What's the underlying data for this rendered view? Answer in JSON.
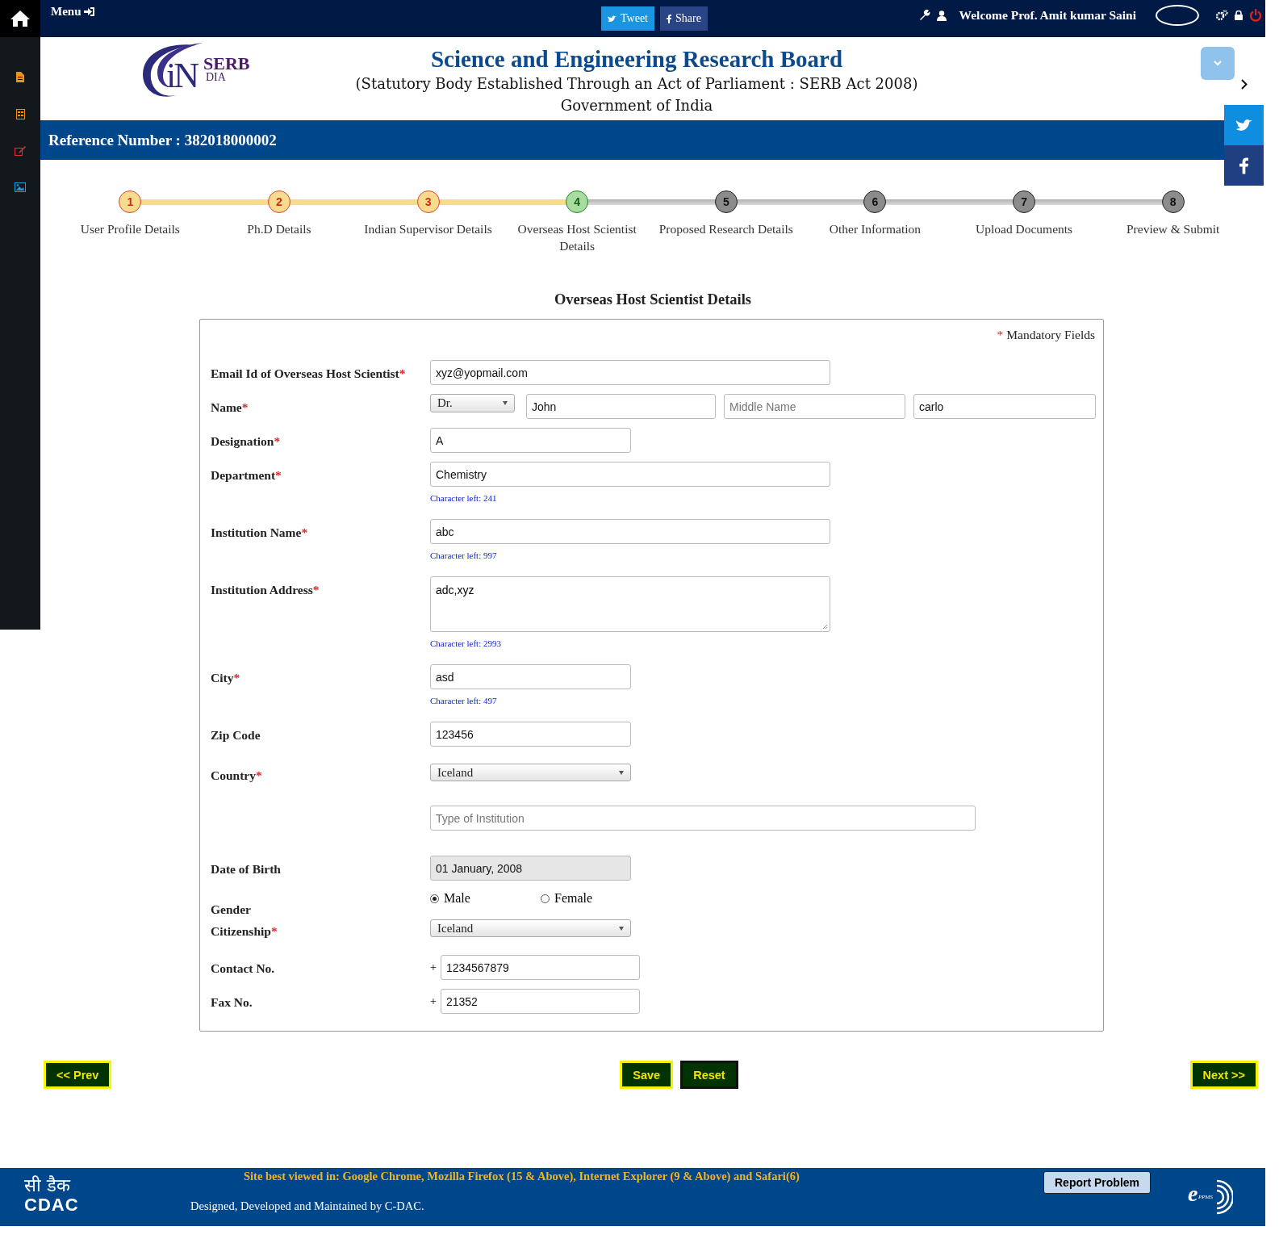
{
  "topbar": {
    "menu": "Menu",
    "tweet": "Tweet",
    "share": "Share",
    "welcome": "Welcome Prof. Amit kumar Saini"
  },
  "header": {
    "logo": {
      "mark": "iN",
      "serb": "SERB",
      "dia": "DIA"
    },
    "title": "Science and Engineering Research Board",
    "subtitle": "(Statutory Body Established Through an Act of Parliament : SERB Act 2008)",
    "government": "Government of India"
  },
  "reference": "Reference Number : 382018000002",
  "steps": [
    {
      "number": "1",
      "label": "User Profile Details",
      "completed": true,
      "selected": false
    },
    {
      "number": "2",
      "label": "Ph.D Details",
      "completed": true,
      "selected": false
    },
    {
      "number": "3",
      "label": "Indian Supervisor Details",
      "completed": true,
      "selected": false
    },
    {
      "number": "4",
      "label": "Overseas Host Scientist Details",
      "completed": false,
      "selected": true
    },
    {
      "number": "5",
      "label": "Proposed Research Details",
      "completed": false,
      "selected": false
    },
    {
      "number": "6",
      "label": "Other Information",
      "completed": false,
      "selected": false
    },
    {
      "number": "7",
      "label": "Upload Documents",
      "completed": false,
      "selected": false
    },
    {
      "number": "8",
      "label": "Preview & Submit",
      "completed": false,
      "selected": false
    }
  ],
  "form": {
    "title": "Overseas Host Scientist Details",
    "mandatory_mark": "*",
    "mandatory_note": "Mandatory Fields",
    "rows": [
      {
        "kind": "input_long",
        "label": "Email Id of Overseas Host Scientist",
        "required": true,
        "value": "xyz@yopmail.com"
      },
      {
        "kind": "name",
        "label": "Name",
        "required": true,
        "title": "Dr.",
        "first": "John",
        "middle_placeholder": "Middle Name",
        "last": "carlo"
      },
      {
        "kind": "input_short",
        "label": "Designation",
        "required": true,
        "value": "A"
      },
      {
        "kind": "input_long",
        "label": "Department",
        "required": true,
        "value": "Chemistry",
        "hint": "Character left: 241"
      },
      {
        "kind": "input_long",
        "label": "Institution Name",
        "required": true,
        "value": "abc",
        "hint": "Character left: 997"
      },
      {
        "kind": "textarea",
        "label": "Institution Address",
        "required": true,
        "value": "adc,xyz",
        "hint": "Character left: 2993"
      },
      {
        "kind": "input_short",
        "label": "City",
        "required": true,
        "value": "asd",
        "hint": "Character left: 497"
      },
      {
        "kind": "input_short",
        "label": "Zip Code",
        "required": false,
        "value": "123456"
      },
      {
        "kind": "select",
        "label": "Country",
        "required": true,
        "value": "Iceland"
      },
      {
        "kind": "input_full",
        "placeholder": "Type of Institution"
      },
      {
        "kind": "input_short",
        "label": "Date of Birth",
        "required": false,
        "value": "01 January, 2008",
        "disabled": true
      },
      {
        "kind": "radio",
        "label": "Gender",
        "required": false,
        "options": [
          {
            "label": "Male",
            "selected": true
          },
          {
            "label": "Female",
            "selected": false
          }
        ]
      },
      {
        "kind": "select",
        "label": "Citizenship",
        "required": true,
        "value": "Iceland"
      },
      {
        "kind": "phone",
        "label": "Contact No.",
        "required": false,
        "prefix": "+",
        "value": "1234567879"
      },
      {
        "kind": "phone",
        "label": "Fax No.",
        "required": false,
        "prefix": "+",
        "value": "21352"
      }
    ]
  },
  "buttons": {
    "prev": "<< Prev",
    "save": "Save",
    "reset": "Reset",
    "next": "Next >>"
  },
  "footer": {
    "cdac_hindi": "सी डैक",
    "cdac": "CDAC",
    "browsers": "Site best viewed in: Google Chrome, Mozilla Firefox (15 & Above), Internet Explorer (9 & Above) and Safari(6)",
    "credit": "Designed, Developed and Maintained by C-DAC.",
    "report": "Report Problem",
    "eppms_e": "e",
    "eppms": "PPMS"
  }
}
